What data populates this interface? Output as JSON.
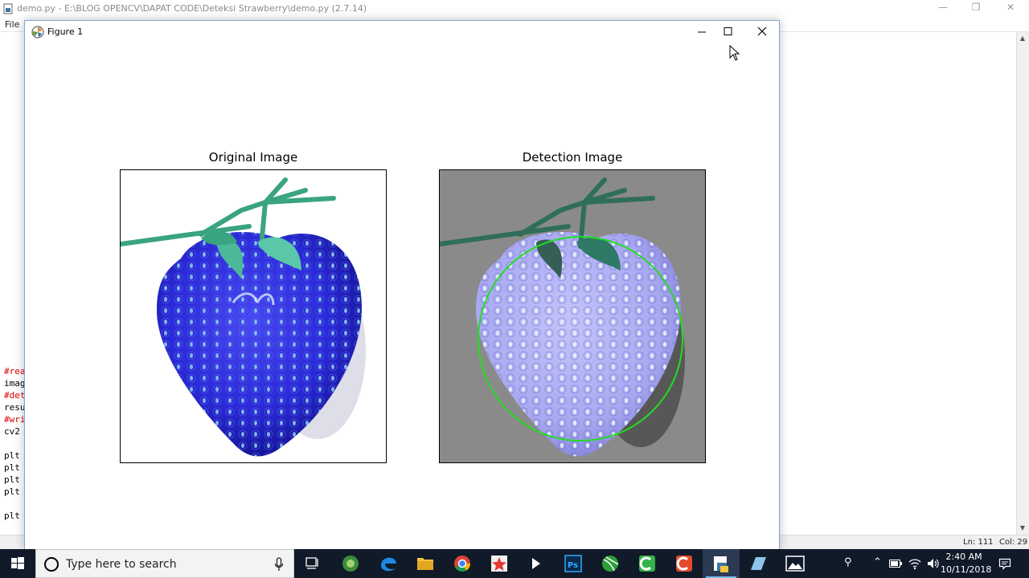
{
  "editor": {
    "title": "demo.py - E:\\BLOG OPENCV\\DAPAT CODE\\Deteksi Strawberry\\demo.py (2.7.14)",
    "menu_file": "File",
    "code_lines": [
      {
        "text": "#rea",
        "kind": "comment"
      },
      {
        "text": "imag",
        "kind": "code"
      },
      {
        "text": "#det",
        "kind": "comment"
      },
      {
        "text": "resu",
        "kind": "code"
      },
      {
        "text": "#wri",
        "kind": "comment"
      },
      {
        "text": "cv2",
        "kind": "code"
      },
      {
        "text": "",
        "kind": "code"
      },
      {
        "text": "plt",
        "kind": "code"
      },
      {
        "text": "plt",
        "kind": "code"
      },
      {
        "text": "plt",
        "kind": "code"
      },
      {
        "text": "plt",
        "kind": "code"
      },
      {
        "text": "",
        "kind": "code"
      },
      {
        "text": "plt",
        "kind": "code"
      }
    ],
    "status_ln": "Ln: 111",
    "status_col": "Col: 29",
    "controls": {
      "minimize": "—",
      "restore": "❐",
      "close": "✕"
    }
  },
  "figure": {
    "title": "Figure 1",
    "left_title": "Original Image",
    "right_title": "Detection Image",
    "colors": {
      "strawberry_original": "#2a2ad6",
      "strawberry_detected": "#a8a8f0",
      "detection_background": "#8a8a8a",
      "detection_circle": "#22dd22",
      "leaves": "#3aa382"
    }
  },
  "taskbar": {
    "search_placeholder": "Type here to search",
    "apps": [
      {
        "name": "task-view",
        "icon": "task-view-icon"
      },
      {
        "name": "android-studio",
        "icon": "android-studio-icon"
      },
      {
        "name": "edge",
        "icon": "edge-icon"
      },
      {
        "name": "file-explorer",
        "icon": "folder-icon"
      },
      {
        "name": "chrome",
        "icon": "chrome-icon"
      },
      {
        "name": "app-star",
        "icon": "star-app-icon"
      },
      {
        "name": "visual-studio",
        "icon": "visual-studio-icon"
      },
      {
        "name": "photoshop",
        "icon": "photoshop-icon"
      },
      {
        "name": "app-green-ball",
        "icon": "green-ball-icon"
      },
      {
        "name": "camtasia",
        "icon": "camtasia-icon"
      },
      {
        "name": "app-red",
        "icon": "red-app-icon"
      },
      {
        "name": "python-idle",
        "icon": "python-idle-icon"
      },
      {
        "name": "app-blue",
        "icon": "blue-app-icon"
      },
      {
        "name": "photos",
        "icon": "photos-icon"
      }
    ],
    "clock_time": "2:40 AM",
    "clock_date": "10/11/2018"
  }
}
